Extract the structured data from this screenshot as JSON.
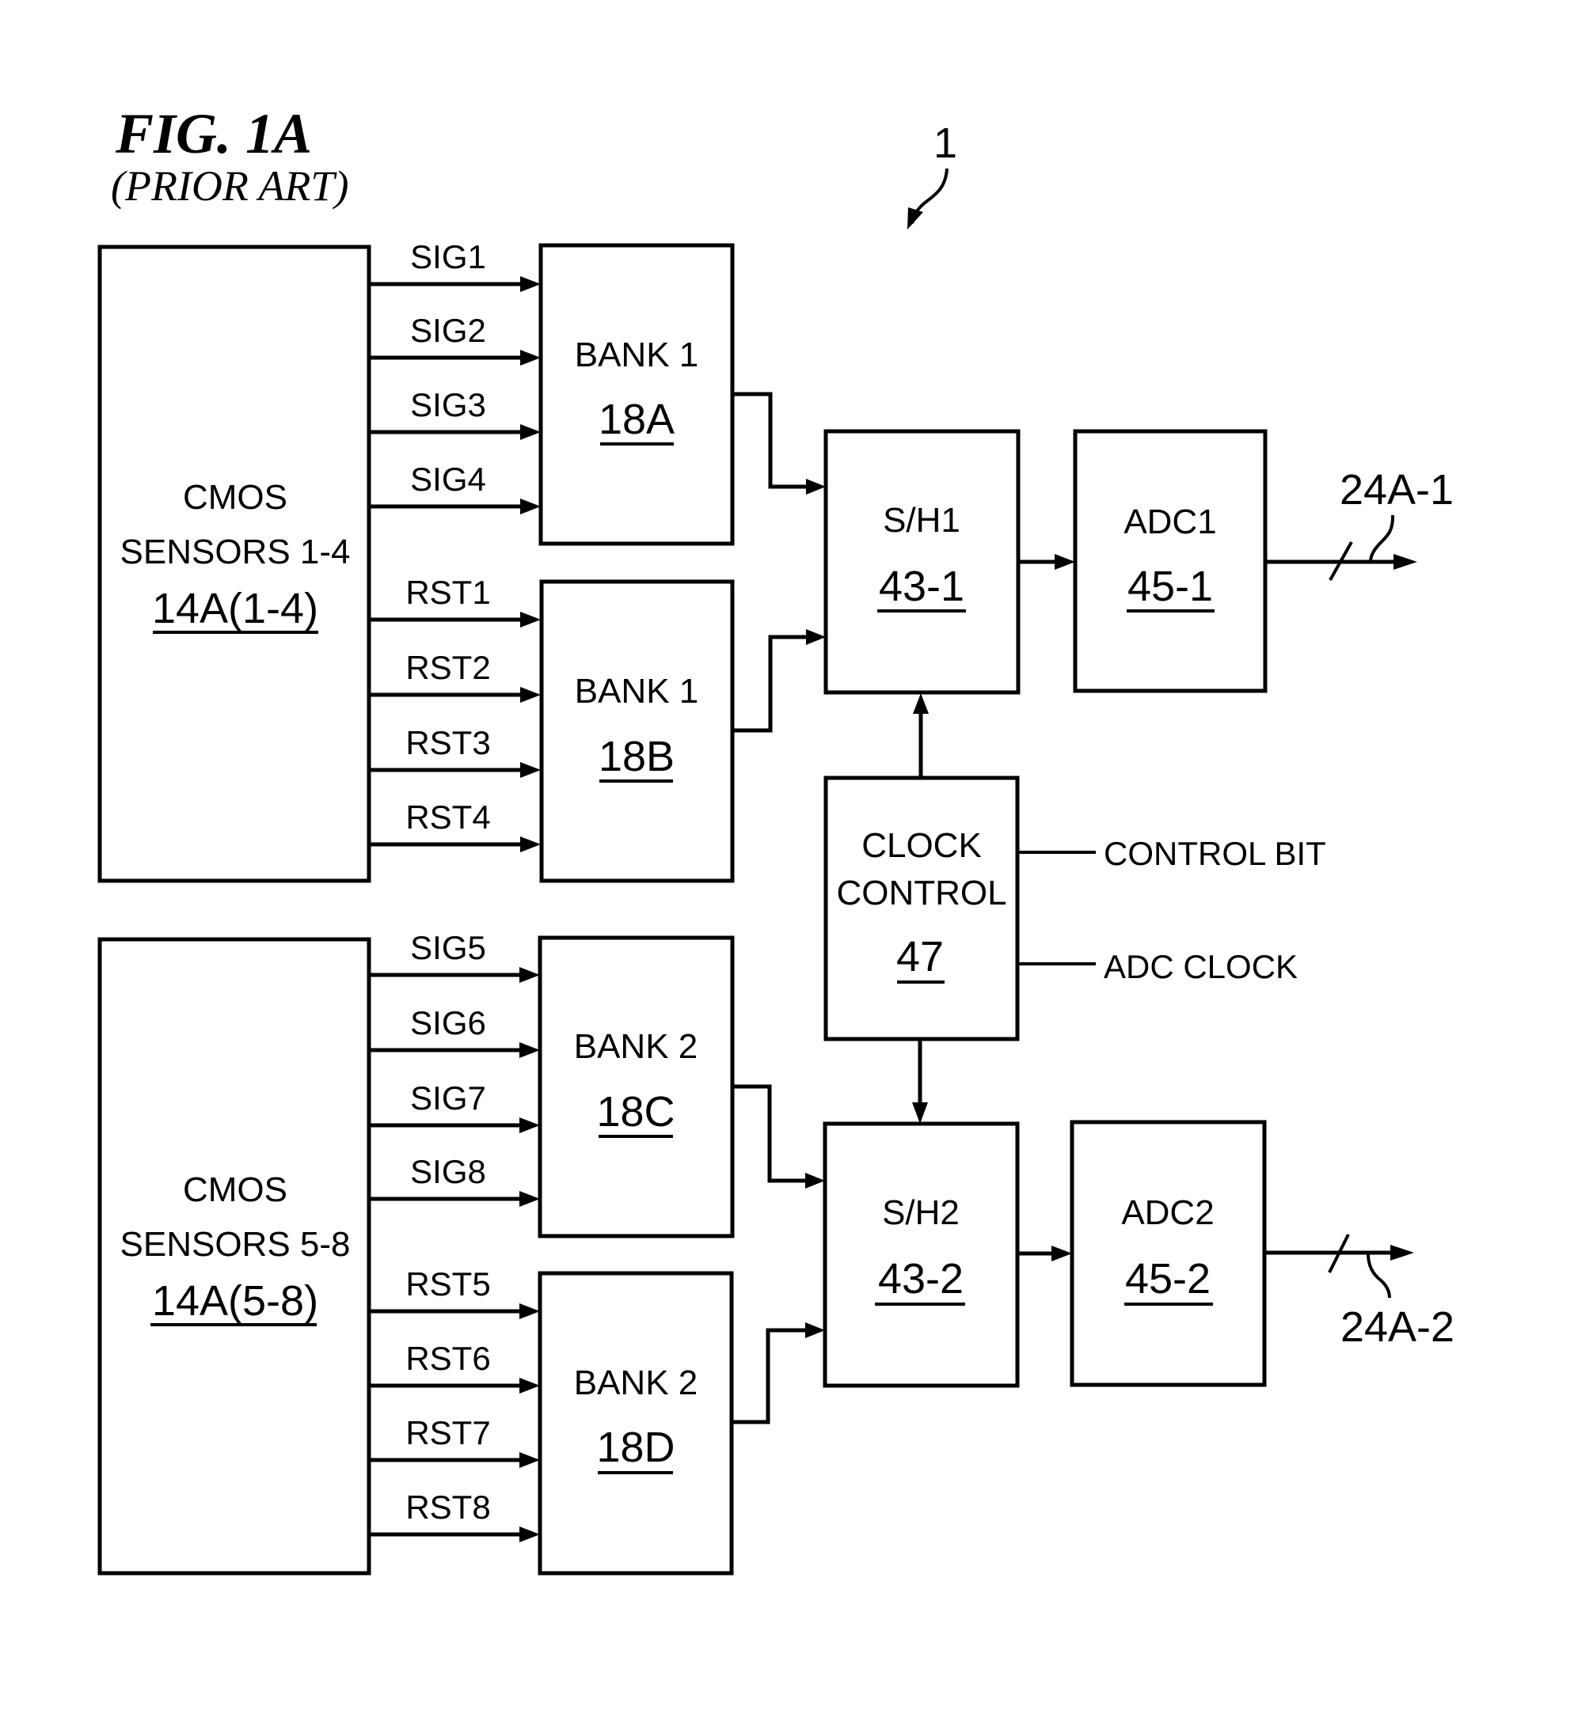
{
  "figure": {
    "title": "FIG. 1A",
    "subtitle": "(PRIOR ART)",
    "system_ref": "1"
  },
  "sensors": [
    {
      "line1": "CMOS",
      "line2": "SENSORS 1-4",
      "ref": "14A(1-4)",
      "sig_labels": [
        "SIG1",
        "SIG2",
        "SIG3",
        "SIG4"
      ],
      "rst_labels": [
        "RST1",
        "RST2",
        "RST3",
        "RST4"
      ]
    },
    {
      "line1": "CMOS",
      "line2": "SENSORS 5-8",
      "ref": "14A(5-8)",
      "sig_labels": [
        "SIG5",
        "SIG6",
        "SIG7",
        "SIG8"
      ],
      "rst_labels": [
        "RST5",
        "RST6",
        "RST7",
        "RST8"
      ]
    }
  ],
  "banks": [
    {
      "name": "BANK 1",
      "ref": "18A"
    },
    {
      "name": "BANK 1",
      "ref": "18B"
    },
    {
      "name": "BANK 2",
      "ref": "18C"
    },
    {
      "name": "BANK 2",
      "ref": "18D"
    }
  ],
  "sample_holds": [
    {
      "name": "S/H1",
      "ref": "43-1"
    },
    {
      "name": "S/H2",
      "ref": "43-2"
    }
  ],
  "adcs": [
    {
      "name": "ADC1",
      "ref": "45-1",
      "output_ref": "24A-1"
    },
    {
      "name": "ADC2",
      "ref": "45-2",
      "output_ref": "24A-2"
    }
  ],
  "clock_control": {
    "line1": "CLOCK",
    "line2": "CONTROL",
    "ref": "47",
    "inputs": [
      "CONTROL BIT",
      "ADC CLOCK"
    ]
  }
}
